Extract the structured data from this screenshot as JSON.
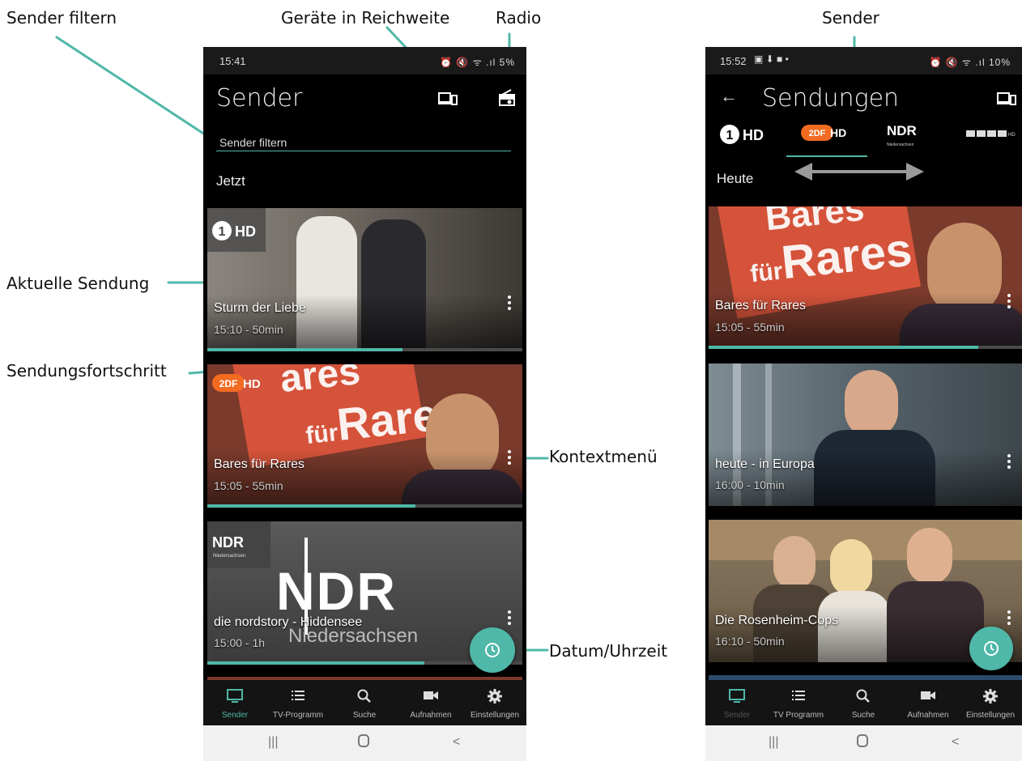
{
  "annotations": {
    "sender_filtern": "Sender filtern",
    "geraete": "Geräte in Reichweite",
    "radio": "Radio",
    "sender": "Sender",
    "aktuelle_sendung": "Aktuelle Sendung",
    "sendungsfortschritt": "Sendungsfortschritt",
    "kontextmenue": "Kontextmenü",
    "datum_uhrzeit": "Datum/Uhrzeit"
  },
  "left_phone": {
    "status_time": "15:41",
    "status_icons": "⏰ 🔇 ᯤ .ıl 5%",
    "title": "Sender",
    "filter_placeholder": "Sender filtern",
    "section": "Jetzt",
    "cards": [
      {
        "channel": "1HD",
        "title": "Sturm der Liebe",
        "meta": "15:10 - 50min",
        "progress": 0.62,
        "bg": "#6b655e"
      },
      {
        "channel": "ZDF HD",
        "title": "Bares für Rares",
        "meta": "15:05 - 55min",
        "progress": 0.66,
        "bg": "#7a3a2c",
        "art_text": "Bares für Rares"
      },
      {
        "channel": "NDR",
        "channel_sub": "Niedersachsen",
        "title": "die nordstory - Hiddensee",
        "meta": "15:00 - 1h",
        "progress": 0.69,
        "bg": "#4a4a4a",
        "art_text": "NDR",
        "art_sub": "Niedersachsen"
      }
    ]
  },
  "right_phone": {
    "status_time": "15:52",
    "status_icons": "⏰ 🔇 ᯤ .ıl 10%",
    "title": "Sendungen",
    "tabs": [
      "1HD",
      "ZDF HD",
      "NDR",
      "RTL HD"
    ],
    "ndr_sub": "Niedersachsen",
    "section": "Heute",
    "cards": [
      {
        "title": "Bares für Rares",
        "meta": "15:05 - 55min",
        "progress": 0.86,
        "bg": "#7a3a2c",
        "art_text": "Rares",
        "art_sub": "für"
      },
      {
        "title": "heute - in Europa",
        "meta": "16:00 - 10min",
        "progress": 0,
        "bg": "#55626a"
      },
      {
        "title": "Die Rosenheim-Cops",
        "meta": "16:10 - 50min",
        "progress": 0,
        "bg": "#7a6a55"
      }
    ]
  },
  "nav": [
    "Sender",
    "TV-Programm",
    "Suche",
    "Aufnahmen",
    "Einstellungen"
  ],
  "nav_right": [
    "Sender",
    "TV Programm",
    "Suche",
    "Aufnahmen",
    "Einstellungen"
  ],
  "colors": {
    "accent": "#4fb8a8",
    "background": "#000000",
    "zdf_orange": "#f26b21"
  }
}
